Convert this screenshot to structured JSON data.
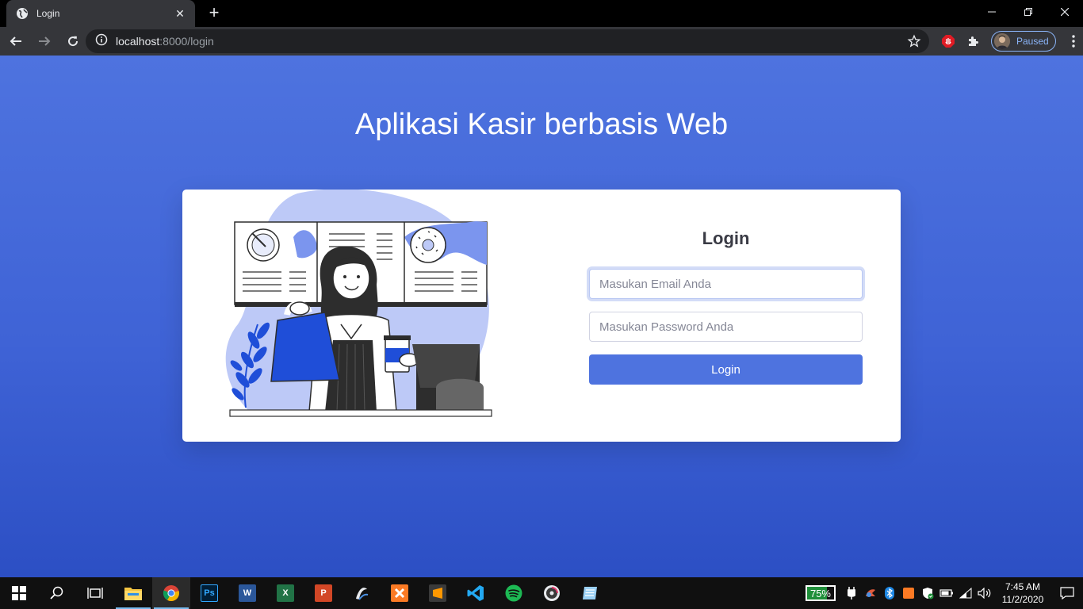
{
  "browser": {
    "tab": {
      "title": "Login",
      "favicon": "globe-icon"
    },
    "url": {
      "host": "localhost",
      "path": ":8000/login"
    },
    "profile": {
      "status": "Paused"
    }
  },
  "page": {
    "title": "Aplikasi Kasir berbasis Web",
    "login": {
      "heading": "Login",
      "email_placeholder": "Masukan Email Anda",
      "password_placeholder": "Masukan Password Anda",
      "button_label": "Login"
    }
  },
  "colors": {
    "primary": "#4e73df",
    "card": "#ffffff",
    "illustration_accent": "#1f4ed8"
  },
  "taskbar": {
    "apps": [
      "windows-start-icon",
      "search-icon",
      "task-view-icon",
      "file-explorer-icon",
      "chrome-icon",
      "photoshop-icon",
      "word-icon",
      "excel-icon",
      "powerpoint-icon",
      "wakatime-icon",
      "xampp-icon",
      "sublime-text-icon",
      "vscode-icon",
      "spotify-icon",
      "media-player-icon",
      "notepad-icon"
    ],
    "battery_percent": "75%",
    "battery_level": 0.75,
    "time": "7:45 AM",
    "date": "11/2/2020"
  }
}
